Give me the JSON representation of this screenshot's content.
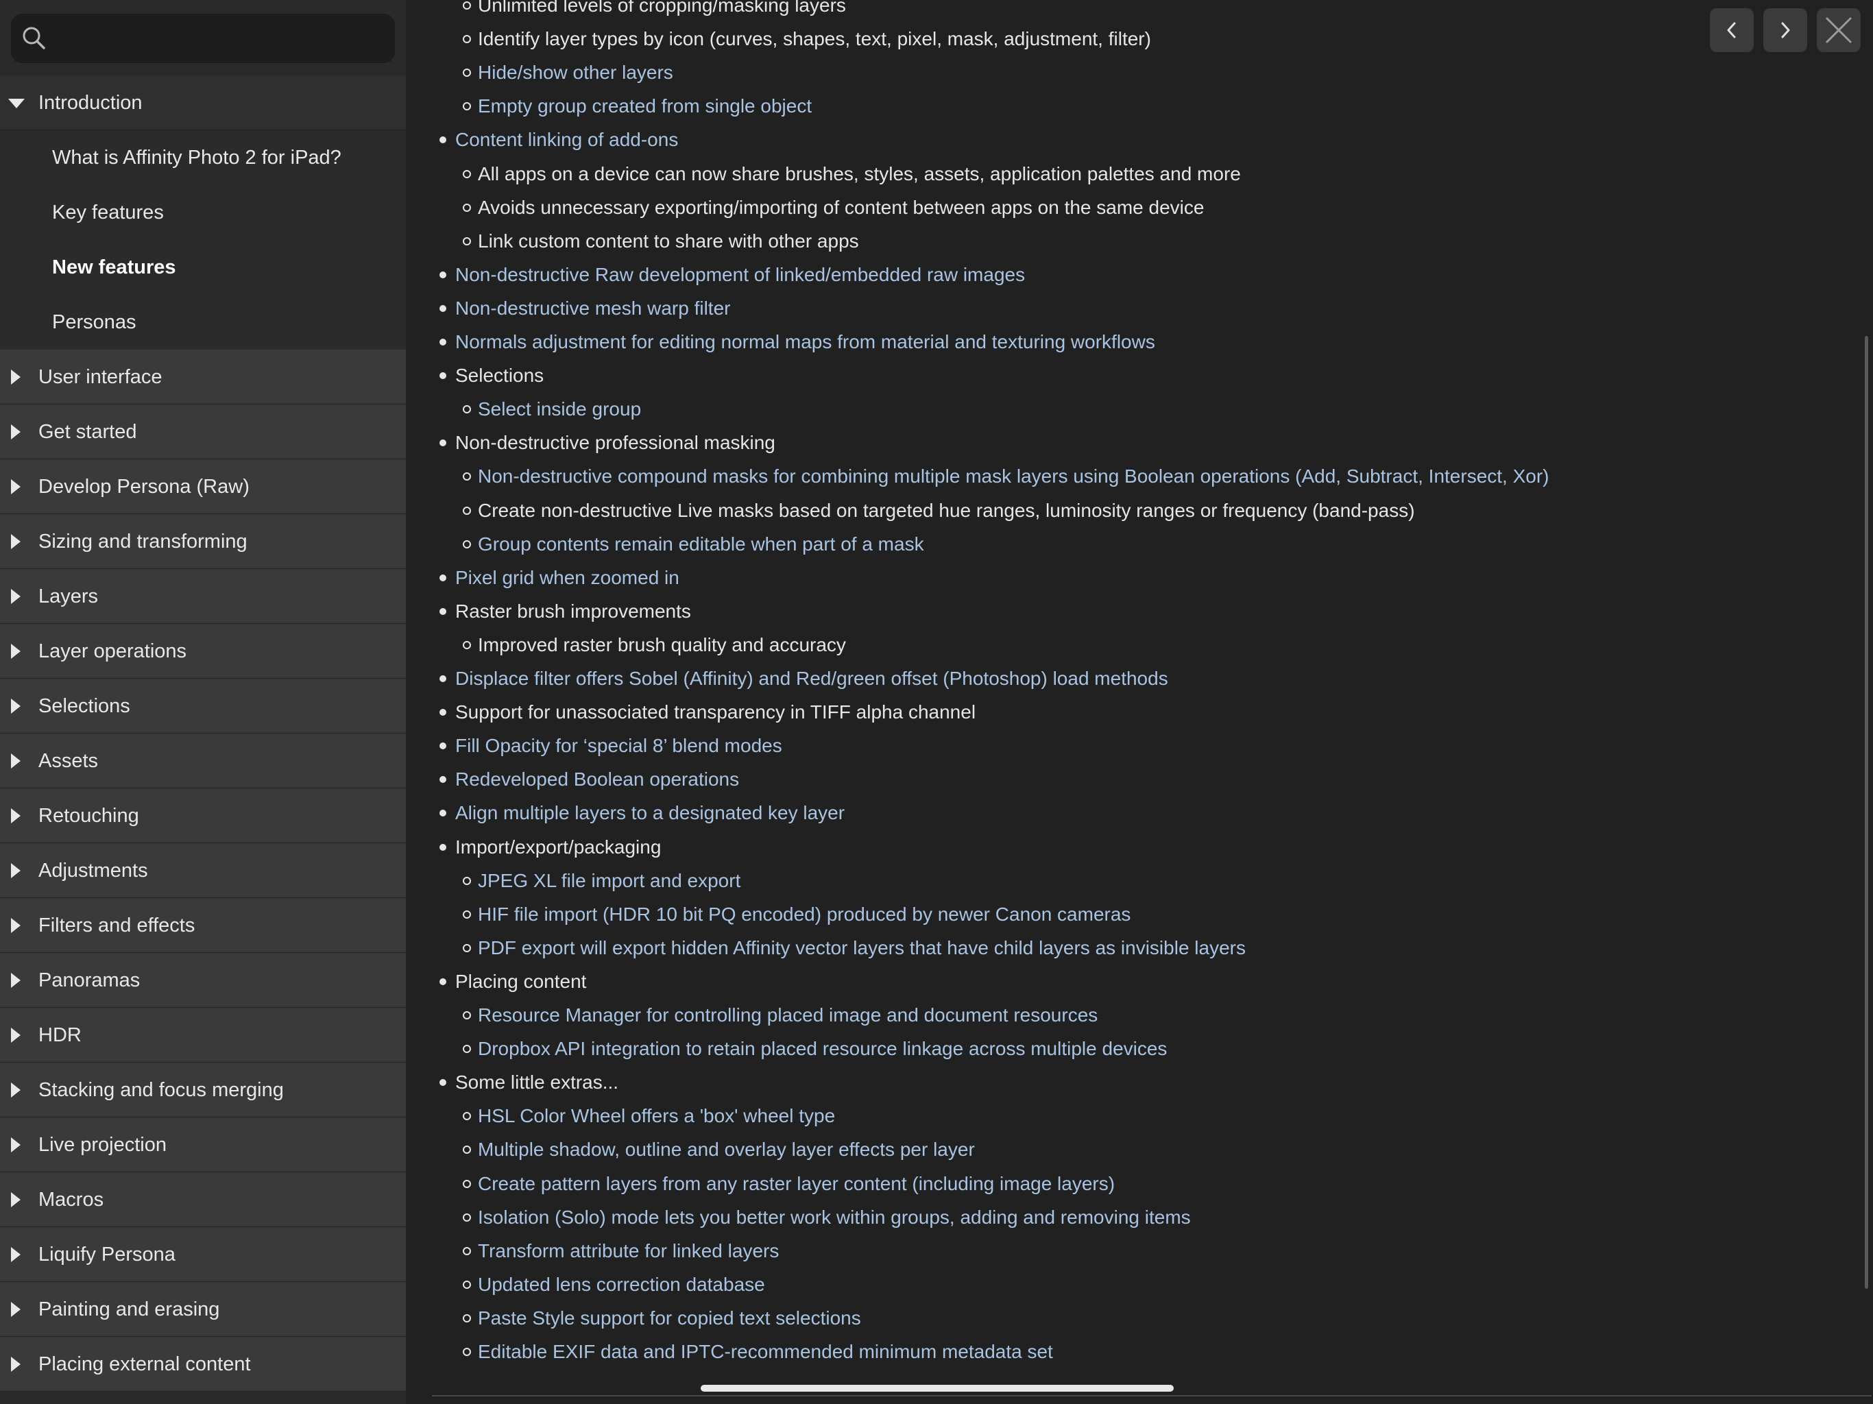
{
  "search": {
    "placeholder": ""
  },
  "sidebar": {
    "intro": {
      "label": "Introduction",
      "children": [
        {
          "label": "What is Affinity Photo 2 for iPad?"
        },
        {
          "label": "Key features"
        },
        {
          "label": "New features",
          "current": true
        },
        {
          "label": "Personas"
        }
      ]
    },
    "sections": [
      "User interface",
      "Get started",
      "Develop Persona (Raw)",
      "Sizing and transforming",
      "Layers",
      "Layer operations",
      "Selections",
      "Assets",
      "Retouching",
      "Adjustments",
      "Filters and effects",
      "Panoramas",
      "HDR",
      "Stacking and focus merging",
      "Live projection",
      "Macros",
      "Liquify Persona",
      "Painting and erasing",
      "Placing external content"
    ]
  },
  "toolbar": {
    "prev_icon": "chevron-left-icon",
    "next_icon": "chevron-right-icon",
    "close_icon": "close-icon"
  },
  "content": {
    "items": [
      {
        "level": 2,
        "link": false,
        "text": "Unlimited levels of cropping/masking layers"
      },
      {
        "level": 2,
        "link": false,
        "text": "Identify layer types by icon (curves, shapes, text, pixel, mask, adjustment, filter)"
      },
      {
        "level": 2,
        "link": true,
        "text": "Hide/show other layers"
      },
      {
        "level": 2,
        "link": true,
        "text": "Empty group created from single object"
      },
      {
        "level": 1,
        "link": true,
        "text": "Content linking of add-ons"
      },
      {
        "level": 2,
        "link": false,
        "text": "All apps on a device can now share brushes, styles, assets, application palettes and more"
      },
      {
        "level": 2,
        "link": false,
        "text": "Avoids unnecessary exporting/importing of content between apps on the same device"
      },
      {
        "level": 2,
        "link": false,
        "text": "Link custom content to share with other apps"
      },
      {
        "level": 1,
        "link": true,
        "text": "Non-destructive Raw development of linked/embedded raw images"
      },
      {
        "level": 1,
        "link": true,
        "text": "Non-destructive mesh warp filter"
      },
      {
        "level": 1,
        "link": true,
        "text": "Normals adjustment for editing normal maps from material and texturing workflows"
      },
      {
        "level": 1,
        "link": false,
        "text": "Selections"
      },
      {
        "level": 2,
        "link": true,
        "text": "Select inside group"
      },
      {
        "level": 1,
        "link": false,
        "text": "Non-destructive professional masking"
      },
      {
        "level": 2,
        "link": true,
        "text": "Non-destructive compound masks for combining multiple mask layers using Boolean operations (Add, Subtract, Intersect, Xor)"
      },
      {
        "level": 2,
        "link": false,
        "text": "Create non-destructive Live masks based on targeted hue ranges, luminosity ranges or frequency (band-pass)"
      },
      {
        "level": 2,
        "link": true,
        "text": "Group contents remain editable when part of a mask"
      },
      {
        "level": 1,
        "link": true,
        "text": "Pixel grid when zoomed in"
      },
      {
        "level": 1,
        "link": false,
        "text": "Raster brush improvements"
      },
      {
        "level": 2,
        "link": false,
        "text": "Improved raster brush quality and accuracy"
      },
      {
        "level": 1,
        "link": true,
        "text": "Displace filter offers Sobel (Affinity) and Red/green offset (Photoshop) load methods"
      },
      {
        "level": 1,
        "link": false,
        "text": "Support for unassociated transparency in TIFF alpha channel"
      },
      {
        "level": 1,
        "link": true,
        "text": "Fill Opacity for ‘special 8’ blend modes"
      },
      {
        "level": 1,
        "link": true,
        "text": "Redeveloped Boolean operations"
      },
      {
        "level": 1,
        "link": true,
        "text": "Align multiple layers to a designated key layer"
      },
      {
        "level": 1,
        "link": false,
        "text": "Import/export/packaging"
      },
      {
        "level": 2,
        "link": true,
        "text": "JPEG XL file import and export"
      },
      {
        "level": 2,
        "link": true,
        "text": "HIF file import (HDR 10 bit PQ encoded) produced by newer Canon cameras"
      },
      {
        "level": 2,
        "link": true,
        "text": "PDF export will export hidden Affinity vector layers that have child layers as invisible layers"
      },
      {
        "level": 1,
        "link": false,
        "text": "Placing content"
      },
      {
        "level": 2,
        "link": true,
        "text": "Resource Manager for controlling placed image and document resources"
      },
      {
        "level": 2,
        "link": true,
        "text": "Dropbox API integration to retain placed resource linkage across multiple devices"
      },
      {
        "level": 1,
        "link": false,
        "text": "Some little extras..."
      },
      {
        "level": 2,
        "link": true,
        "text": "HSL Color Wheel offers a 'box' wheel type"
      },
      {
        "level": 2,
        "link": true,
        "text": "Multiple shadow, outline and overlay layer effects per layer"
      },
      {
        "level": 2,
        "link": true,
        "text": "Create pattern layers from any raster layer content (including image layers)"
      },
      {
        "level": 2,
        "link": true,
        "text": "Isolation (Solo) mode lets you better work within groups, adding and removing items"
      },
      {
        "level": 2,
        "link": true,
        "text": "Transform attribute for linked layers"
      },
      {
        "level": 2,
        "link": true,
        "text": "Updated lens correction database"
      },
      {
        "level": 2,
        "link": true,
        "text": "Paste Style support for copied text selections"
      },
      {
        "level": 2,
        "link": true,
        "text": "Editable EXIF data and IPTC-recommended minimum metadata set"
      }
    ]
  }
}
